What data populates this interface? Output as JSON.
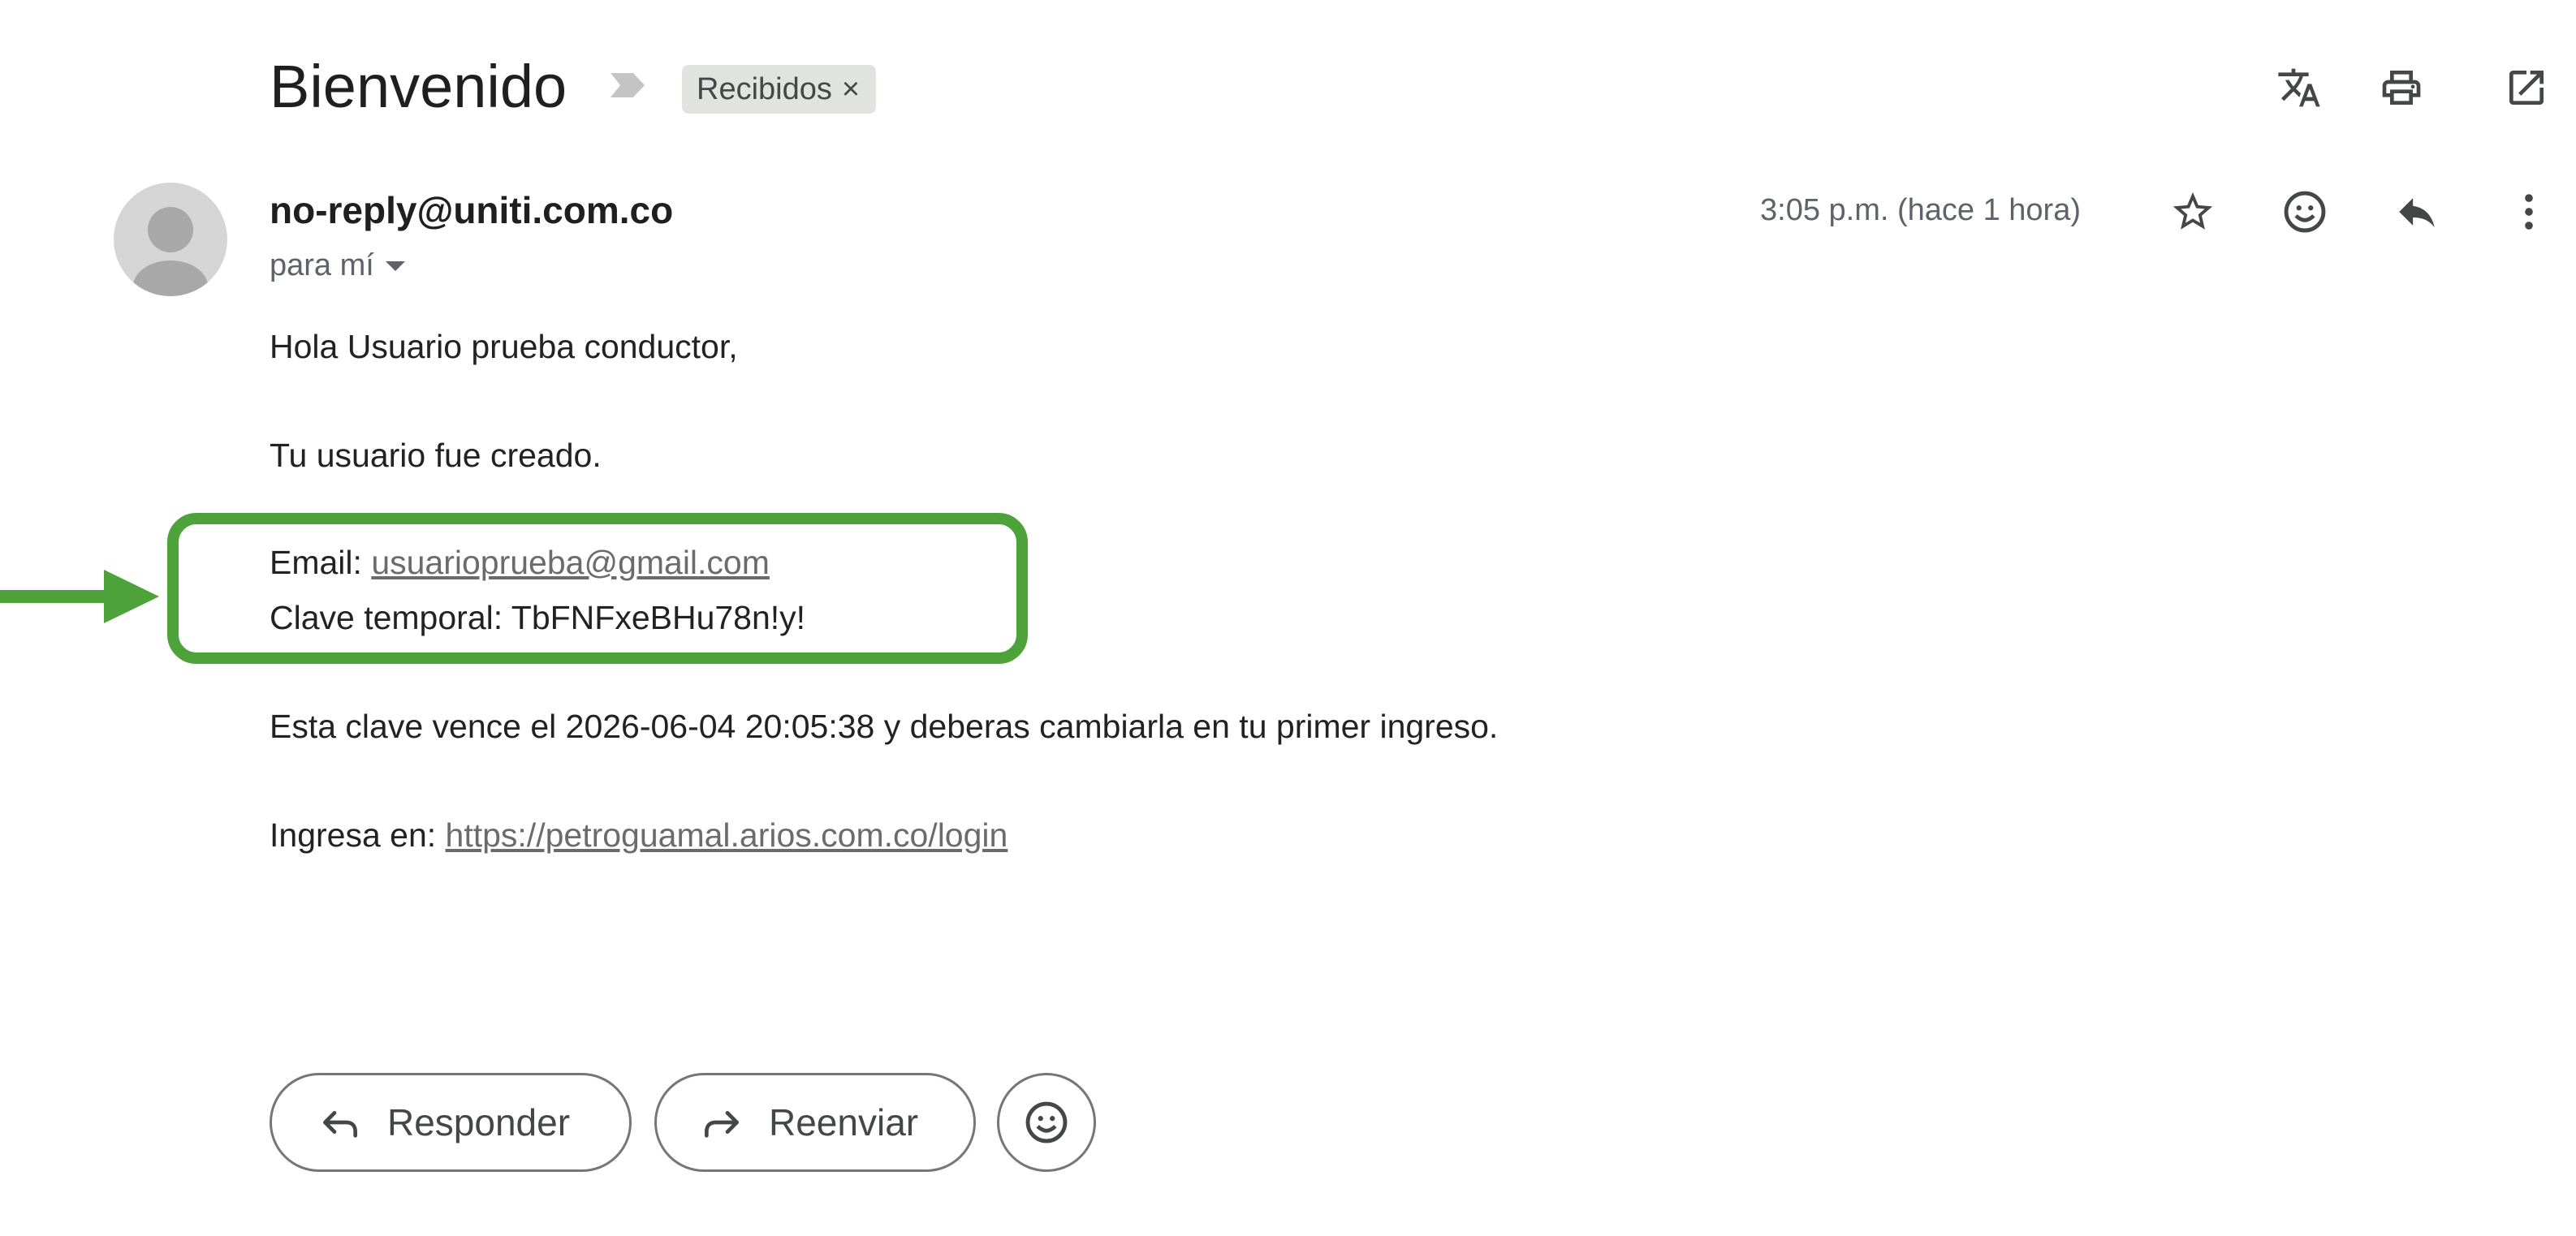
{
  "subject": "Bienvenido",
  "label_chip": {
    "text": "Recibidos",
    "close": "×"
  },
  "toolbar_icons": [
    "translate-icon",
    "print-icon",
    "open-in-new-window-icon"
  ],
  "message": {
    "sender": "no-reply@uniti.com.co",
    "recipient": "para mí",
    "timestamp": "3:05 p.m. (hace 1 hora)",
    "header_icons": [
      "star-icon",
      "emoji-icon",
      "reply-icon",
      "more-vert-icon"
    ],
    "body": {
      "greeting": "Hola Usuario prueba conductor,",
      "line1": "Tu usuario fue creado.",
      "email_label": "Email: ",
      "email_value": "usuarioprueba@gmail.com",
      "password_line": "Clave temporal: TbFNFxeBHu78n!y!",
      "expiry_line": "Esta clave vence el 2026-06-04 20:05:38 y deberas cambiarla en tu primer ingreso.",
      "login_label": "Ingresa en: ",
      "login_url": "https://petroguamal.arios.com.co/login"
    }
  },
  "actions": {
    "reply": "Responder",
    "forward": "Reenviar"
  },
  "colors": {
    "highlight": "#4da33a",
    "chip_bg": "#e1e3e1",
    "text": "#202124",
    "muted": "#5f6368"
  }
}
